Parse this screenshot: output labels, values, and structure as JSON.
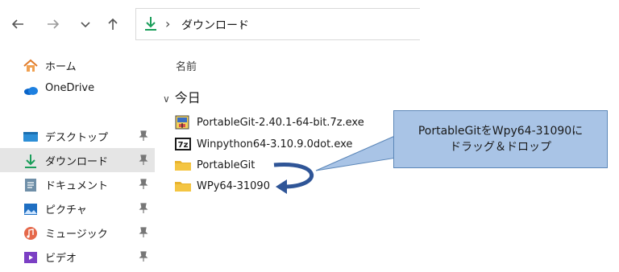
{
  "toolbar": {
    "back_icon": "arrow-left-icon",
    "forward_icon": "arrow-right-icon",
    "recent_icon": "chevron-down-icon",
    "up_icon": "arrow-up-icon",
    "address": {
      "icon": "download-icon",
      "separator1": "›",
      "crumb": "ダウンロード",
      "separator2": "›"
    }
  },
  "sidebar": {
    "items": [
      {
        "label": "ホーム",
        "icon": "home-icon",
        "pinned": false
      },
      {
        "label": "OneDrive",
        "icon": "cloud-icon",
        "pinned": false
      },
      {
        "label": "デスクトップ",
        "icon": "desktop-icon",
        "pinned": true
      },
      {
        "label": "ダウンロード",
        "icon": "download-icon",
        "pinned": true,
        "selected": true
      },
      {
        "label": "ドキュメント",
        "icon": "document-icon",
        "pinned": true
      },
      {
        "label": "ピクチャ",
        "icon": "pictures-icon",
        "pinned": true
      },
      {
        "label": "ミュージック",
        "icon": "music-icon",
        "pinned": true
      },
      {
        "label": "ビデオ",
        "icon": "video-icon",
        "pinned": true
      }
    ],
    "pin_glyph": "📌"
  },
  "main": {
    "column_header": "名前",
    "group": {
      "chevron": "∨",
      "label": "今日"
    },
    "files": [
      {
        "name": "PortableGit-2.40.1-64-bit.7z.exe",
        "icon": "installer-exe-icon"
      },
      {
        "name": "Winpython64-3.10.9.0dot.exe",
        "icon": "7z-exe-icon"
      },
      {
        "name": "PortableGit",
        "icon": "folder-icon"
      },
      {
        "name": "WPy64-31090",
        "icon": "folder-icon"
      }
    ]
  },
  "annotation": {
    "line1": "PortableGitをWpy64-31090に",
    "line2": "ドラッグ＆ドロップ",
    "fill": "#a9c4e6",
    "arrow_color": "#2f5597"
  },
  "colors": {
    "accent_green": "#1a9e5a",
    "folder_yellow": "#f4c542",
    "selected_bg": "#e5e5e5"
  }
}
